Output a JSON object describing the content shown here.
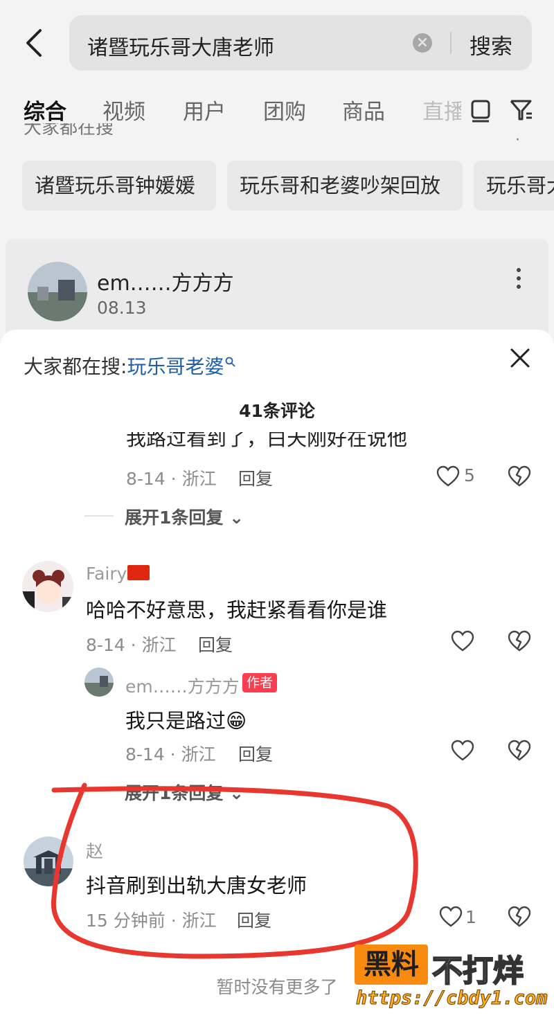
{
  "search": {
    "query": "诸暨玩乐哥大唐老师",
    "button": "搜索"
  },
  "tabs": [
    "综合",
    "视频",
    "用户",
    "团购",
    "商品",
    "直播"
  ],
  "trending_heading": "大家都在搜",
  "chips": [
    "诸暨玩乐哥钟媛媛",
    "玩乐哥和老婆吵架回放",
    "玩乐哥大"
  ],
  "post": {
    "author": "em……方方方",
    "date": "08.13"
  },
  "sheet": {
    "hot_prefix": "大家都在搜:",
    "hot_keyword": "玩乐哥老婆",
    "count": "41条评论"
  },
  "comments": {
    "top_cut": {
      "text": "我路过看到了，白天刚好在说他",
      "meta": "8-14 · 浙江",
      "reply": "回复",
      "likes": "5",
      "expand": "展开1条回复"
    },
    "fairy": {
      "name": "Fairy",
      "text": "哈哈不好意思，我赶紧看看你是谁",
      "meta": "8-14 · 浙江",
      "reply": "回复"
    },
    "author_reply": {
      "name": "em……方方方",
      "tag": "作者",
      "text": "我只是路过",
      "emoji": "😁",
      "meta": "8-14 · 浙江",
      "reply": "回复",
      "expand": "展开1条回复"
    },
    "zhao": {
      "name": "赵",
      "text": "抖音刷到出轨大唐女老师",
      "meta": "15 分钟前 · 浙江",
      "reply": "回复",
      "likes": "1"
    }
  },
  "footer": {
    "no_more": "暂时没有更多了"
  },
  "watermark": {
    "badge": "黑料",
    "title": "不打烊",
    "url": "https://cbdy1.com"
  },
  "colors": {
    "keyword_blue": "#1f5ea8",
    "author_tag_red": "#fb3e4f",
    "annotation_red": "#e8372f",
    "watermark_orange": "#f88a0f"
  }
}
